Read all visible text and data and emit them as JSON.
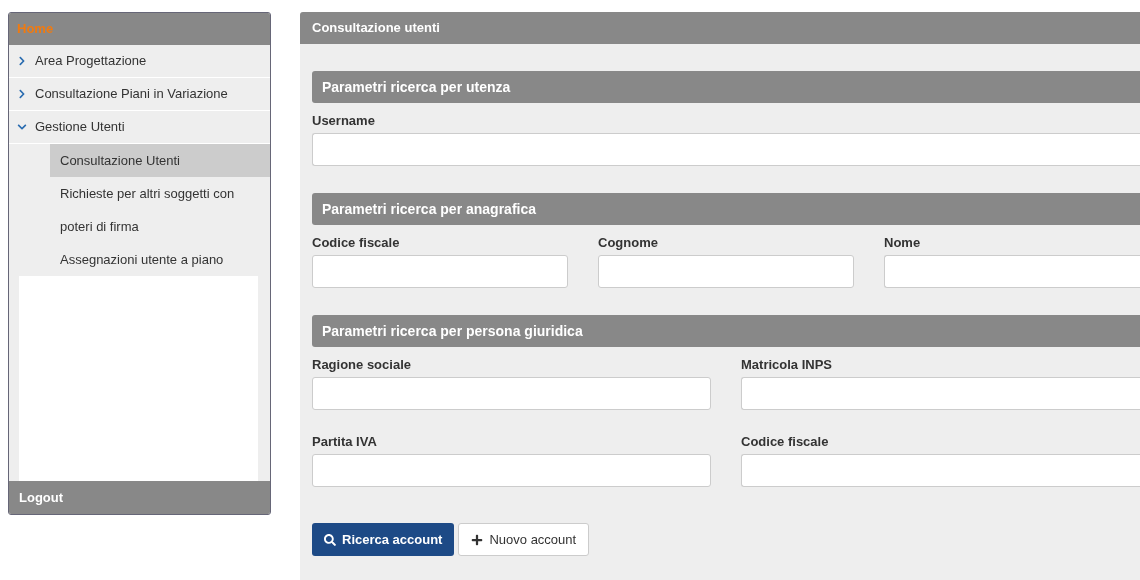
{
  "sidebar": {
    "home": "Home",
    "items": [
      {
        "label": "Area Progettazione",
        "expanded": false
      },
      {
        "label": "Consultazione Piani in Variazione",
        "expanded": false
      },
      {
        "label": "Gestione Utenti",
        "expanded": true,
        "children": [
          {
            "label": "Consultazione Utenti",
            "selected": true
          },
          {
            "label": "Richieste per altri soggetti con poteri di firma",
            "selected": false
          },
          {
            "label": "Assegnazioni utente a piano",
            "selected": false
          }
        ]
      }
    ],
    "logout": "Logout"
  },
  "main": {
    "title": "Consultazione utenti",
    "sections": [
      {
        "title": "Parametri ricerca per utenza",
        "rows": [
          [
            {
              "label": "Username"
            }
          ]
        ]
      },
      {
        "title": "Parametri ricerca per anagrafica",
        "rows": [
          [
            {
              "label": "Codice fiscale"
            },
            {
              "label": "Cognome"
            },
            {
              "label": "Nome"
            }
          ]
        ]
      },
      {
        "title": "Parametri ricerca per persona giuridica",
        "rows": [
          [
            {
              "label": "Ragione sociale"
            },
            {
              "label": "Matricola INPS"
            }
          ],
          [
            {
              "label": "Partita IVA"
            },
            {
              "label": "Codice fiscale"
            }
          ]
        ]
      }
    ],
    "buttons": [
      {
        "kind": "primary",
        "label": "Ricerca account"
      },
      {
        "kind": "secondary",
        "label": "Nuovo account"
      }
    ]
  }
}
